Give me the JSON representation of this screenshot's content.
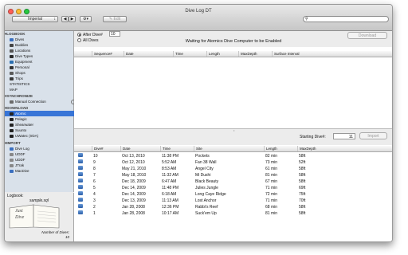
{
  "window": {
    "title": "Dive Log DT"
  },
  "toolbar": {
    "logbook_select": "Imperial",
    "edit_label": "Edit",
    "search_placeholder": ""
  },
  "sidebar": {
    "logbook_header": "LOGBOOK",
    "logbook_items": [
      "Dives",
      "Buddies",
      "Locations",
      "Dive Types",
      "Equipment",
      "Personal",
      "Shops",
      "Trips",
      "STATISTICS",
      "MAP"
    ],
    "sync_header": "SYNCHRONIZE",
    "sync_items": [
      "Manual Connection"
    ],
    "download_header": "DOWNLOAD",
    "download_items": [
      "Atomic",
      "Pelagic",
      "Shearwater",
      "Suunto",
      "UWatec (IrDA)"
    ],
    "import_header": "IMPORT",
    "import_items": [
      "Dive Log",
      "UDDF",
      "UDDF",
      "JTrak",
      "MacDive"
    ]
  },
  "logbook_pane": {
    "label": "Logbook:",
    "filename": "sample.sql",
    "book_text_1": "Just",
    "book_text_2": "Dive",
    "dives_label": "Number of Dives:",
    "dives_count": "10"
  },
  "download": {
    "after_dive_label": "After Dive#",
    "after_dive_value": "10",
    "all_dives_label": "All Dives",
    "waiting_text": "Waiting for Atomics Dive Computer to be Enabled",
    "download_button": "Download",
    "columns": [
      "Sequence#",
      "Date",
      "Time",
      "Length",
      "MaxDepth",
      "Surface Interval"
    ],
    "starting_dive_label": "Starting Dive#:",
    "starting_dive_value": "11",
    "import_button": "Import"
  },
  "dives_table": {
    "columns": [
      "Dive#",
      "Date",
      "Time",
      "Site",
      "Length",
      "MaxDepth"
    ],
    "rows": [
      [
        "10",
        "Oct 13, 2010",
        "11:38 PM",
        "Pockets",
        "82 min",
        "58ft"
      ],
      [
        "9",
        "Oct 12, 2010",
        "5:52 AM",
        "Fan 38 Wall",
        "73 min",
        "52ft"
      ],
      [
        "8",
        "May 21, 2010",
        "8:53 AM",
        "Angel City",
        "61 min",
        "58ft"
      ],
      [
        "7",
        "May 18, 2010",
        "11:32 AM",
        "Mi Dushi",
        "81 min",
        "58ft"
      ],
      [
        "6",
        "Dec 18, 2009",
        "6:47 AM",
        "Black Beauty",
        "67 min",
        "58ft"
      ],
      [
        "5",
        "Dec 14, 2009",
        "11:48 PM",
        "Julies Jungle",
        "71 min",
        "69ft"
      ],
      [
        "4",
        "Dec 14, 2009",
        "6:18 AM",
        "Long Caye Ridge",
        "72 min",
        "75ft"
      ],
      [
        "3",
        "Dec 13, 2009",
        "11:13 AM",
        "Lost Anchor",
        "71 min",
        "70ft"
      ],
      [
        "2",
        "Jan 28, 2008",
        "12:36 PM",
        "Rabbi's Reef",
        "68 min",
        "58ft"
      ],
      [
        "1",
        "Jan 28, 2008",
        "10:17 AM",
        "Suck'em Up",
        "81 min",
        "58ft"
      ]
    ]
  }
}
